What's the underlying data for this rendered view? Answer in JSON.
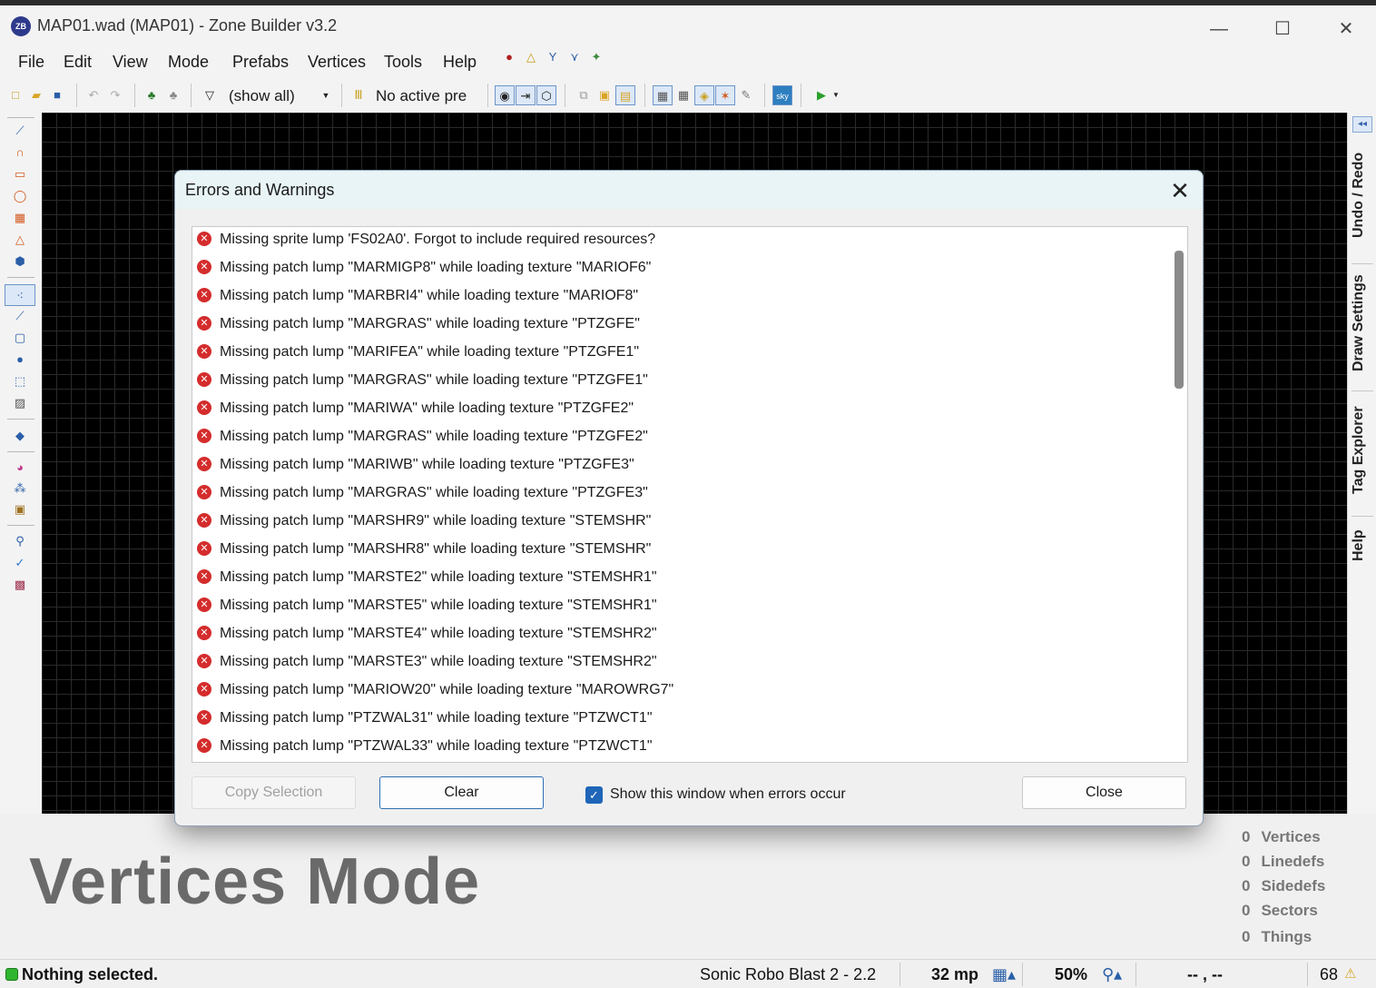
{
  "window": {
    "title": "MAP01.wad (MAP01) - Zone Builder v3.2",
    "app_icon": "ZB",
    "minimize": "—",
    "maximize": "☐",
    "close": "✕"
  },
  "menu": [
    "File",
    "Edit",
    "View",
    "Mode",
    "Prefabs",
    "Vertices",
    "Tools",
    "Help"
  ],
  "toolbar": {
    "filter_label": "(show all)",
    "preset_label": "No active pre",
    "test_icon": "▶"
  },
  "dock_tabs": [
    "Undo / Redo",
    "Draw Settings",
    "Tag Explorer",
    "Help"
  ],
  "dialog": {
    "title": "Errors and Warnings",
    "close_glyph": "✕",
    "error_glyph": "✕",
    "messages": [
      "Missing sprite lump 'FS02A0'. Forgot to include required resources?",
      "Missing patch lump \"MARMIGP8\" while loading texture \"MARIOF6\"",
      "Missing patch lump \"MARBRI4\" while loading texture \"MARIOF8\"",
      "Missing patch lump \"MARGRAS\" while loading texture \"PTZGFE\"",
      "Missing patch lump \"MARIFEA\" while loading texture \"PTZGFE1\"",
      "Missing patch lump \"MARGRAS\" while loading texture \"PTZGFE1\"",
      "Missing patch lump \"MARIWA\" while loading texture \"PTZGFE2\"",
      "Missing patch lump \"MARGRAS\" while loading texture \"PTZGFE2\"",
      "Missing patch lump \"MARIWB\" while loading texture \"PTZGFE3\"",
      "Missing patch lump \"MARGRAS\" while loading texture \"PTZGFE3\"",
      "Missing patch lump \"MARSHR9\" while loading texture \"STEMSHR\"",
      "Missing patch lump \"MARSHR8\" while loading texture \"STEMSHR\"",
      "Missing patch lump \"MARSTE2\" while loading texture \"STEMSHR1\"",
      "Missing patch lump \"MARSTE5\" while loading texture \"STEMSHR1\"",
      "Missing patch lump \"MARSTE4\" while loading texture \"STEMSHR2\"",
      "Missing patch lump \"MARSTE3\" while loading texture \"STEMSHR2\"",
      "Missing patch lump \"MARIOW20\" while loading texture \"MAROWRG7\"",
      "Missing patch lump \"PTZWAL31\" while loading texture \"PTZWCT1\"",
      "Missing patch lump \"PTZWAL33\" while loading texture \"PTZWCT1\""
    ],
    "copy_selection": "Copy Selection",
    "clear": "Clear",
    "show_window_label": "Show this window when errors occur",
    "show_window_checked": true,
    "check_glyph": "✓",
    "close_button": "Close"
  },
  "info_panel": {
    "mode": "Vertices Mode",
    "stats": [
      {
        "count": "0",
        "label": "Vertices"
      },
      {
        "count": "0",
        "label": "Linedefs"
      },
      {
        "count": "0",
        "label": "Sidedefs"
      },
      {
        "count": "0",
        "label": "Sectors"
      },
      {
        "count": "0",
        "label": "Things"
      }
    ]
  },
  "status": {
    "message": "Nothing selected.",
    "game_config": "Sonic Robo Blast 2 - 2.2",
    "grid": "32 mp",
    "zoom": "50%",
    "coords": "-- , --",
    "warnings": "68",
    "warning_glyph": "⚠"
  },
  "colors": {
    "status_ok": "#2fb52f",
    "error_icon": "#d42c2c",
    "checkbox": "#1f65b8",
    "canvas": "#000000"
  }
}
